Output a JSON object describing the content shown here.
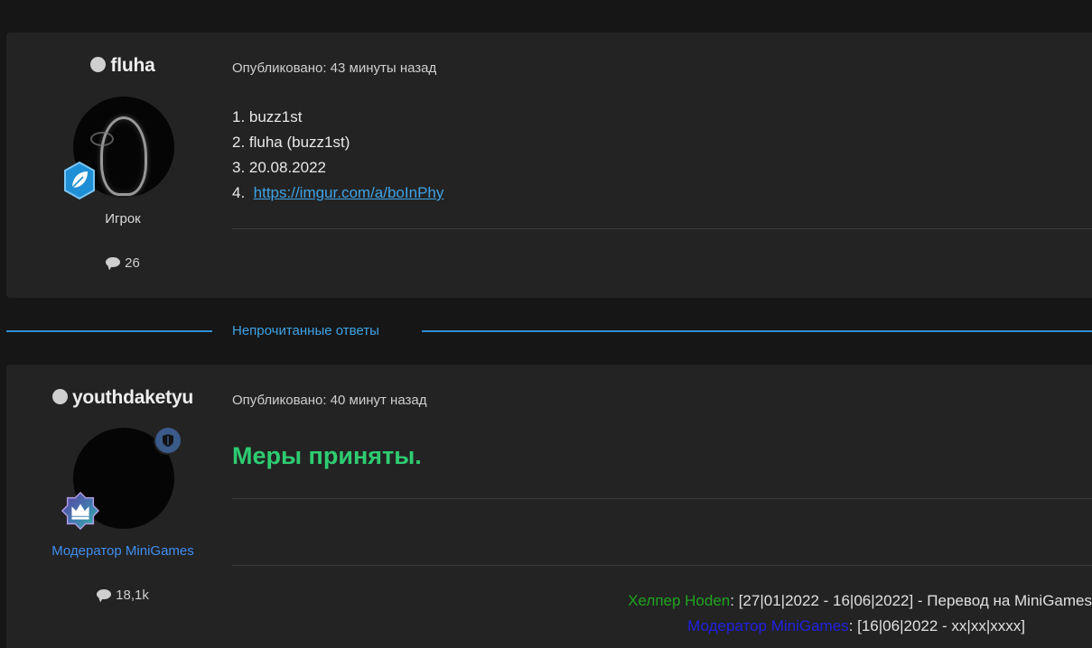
{
  "posts": [
    {
      "author": "fluha",
      "title": "Игрок",
      "post_count": "26",
      "published": "Опубликовано: 43 минуты назад",
      "lines": [
        "1. buzz1st",
        "2. fluha (buzz1st)",
        "3. 20.08.2022"
      ],
      "link_prefix": "4.",
      "link_text": "https://imgur.com/a/boInPhy"
    },
    {
      "author": "youthdaketyu",
      "title": "Модератор MiniGames",
      "post_count": "18,1k",
      "published": "Опубликовано: 40 минут назад",
      "message": "Меры приняты.",
      "signature": [
        {
          "role": "Хелпер Hoden",
          "text": ": [27|01|2022 - 16|06|2022] - Перевод на MiniGames"
        },
        {
          "role": "Модератор MiniGames",
          "text": ": [16|06|2022 - xx|xx|xxxx]"
        }
      ]
    }
  ],
  "separator_label": "Непрочитанные ответы",
  "colors": {
    "accent": "#3fa3e6",
    "message_green": "#2ecc71",
    "moderator_blue": "#3f8ef0",
    "helper_green": "#1fa51f",
    "sig_mod_blue": "#2020e0"
  },
  "icons": {
    "rank_player": "leaf-icon",
    "rank_moderator": "crown-icon",
    "moderator_badge": "shield-icon",
    "posts": "comment-icon",
    "status": "offline-dot-icon"
  }
}
